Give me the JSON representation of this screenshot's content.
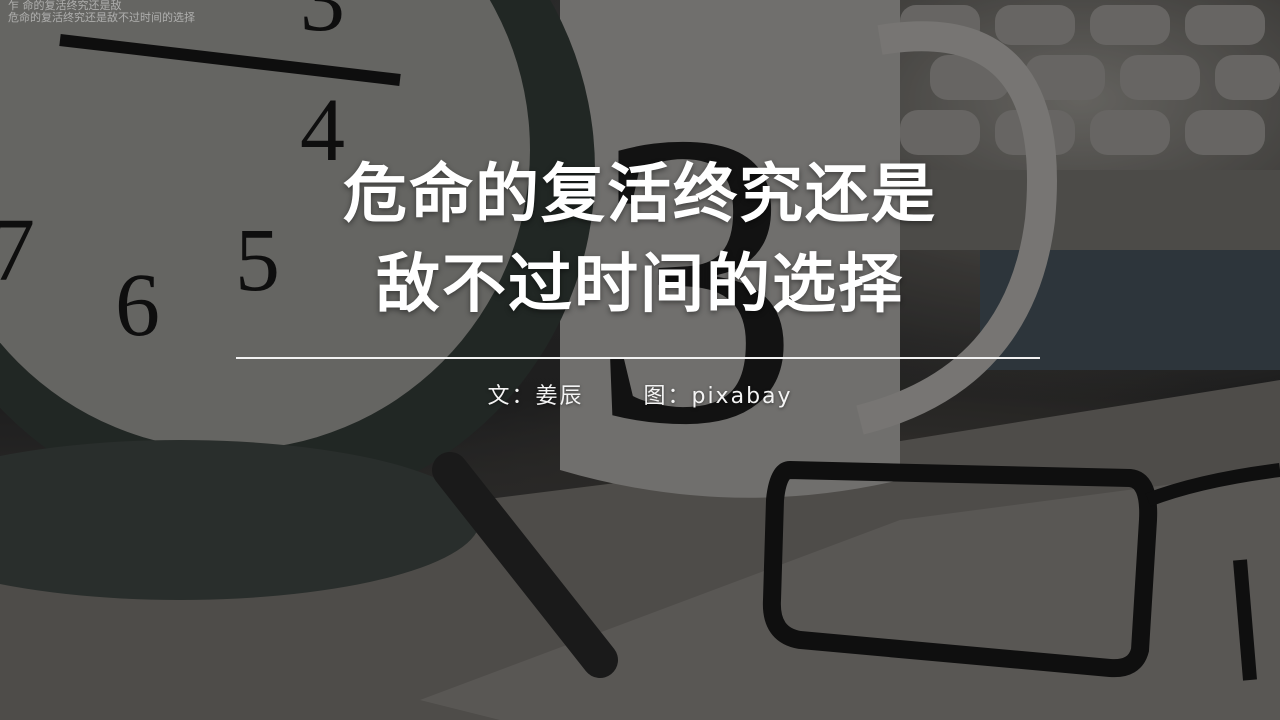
{
  "watermark": {
    "lines": [
      "乍 命的复活终究还是敌",
      "危命的复活终究还是敌不过时间的选择"
    ]
  },
  "title": {
    "line1": "危命的复活终究还是",
    "line2": "敌不过时间的选择"
  },
  "credits": {
    "author": "文：姜辰",
    "image": "图：pixabay"
  },
  "photo_objects": [
    "alarm-clock",
    "coffee-mug",
    "typewriter-keys",
    "eyeglasses",
    "paper"
  ]
}
